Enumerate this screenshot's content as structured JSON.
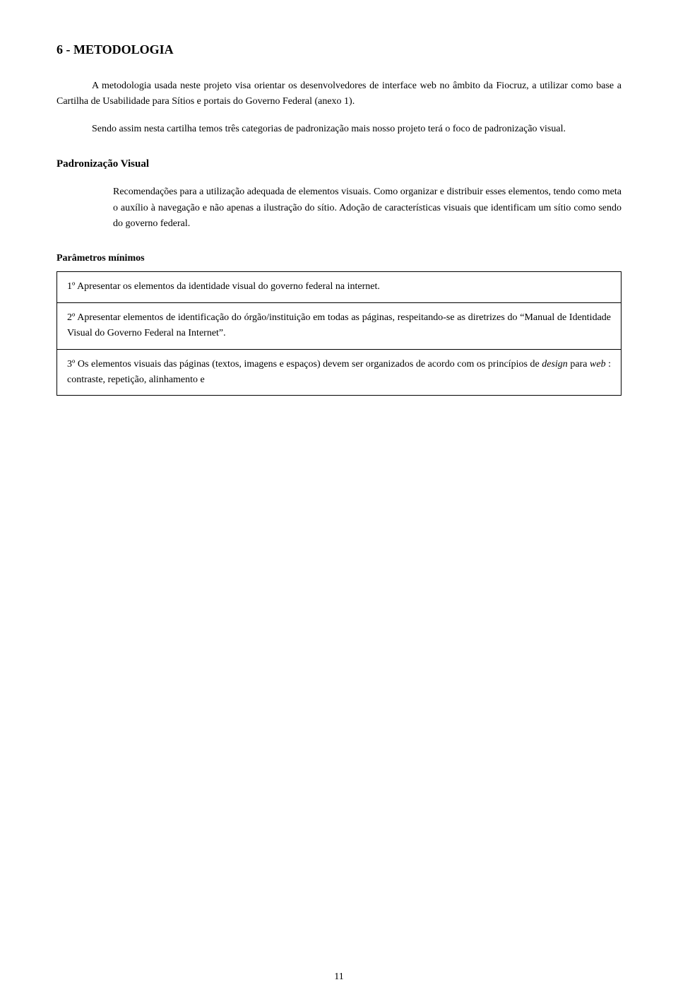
{
  "page": {
    "section_title": "6 - METODOLOGIA",
    "paragraph1": "A metodologia usada neste projeto visa orientar os desenvolvedores de interface web no âmbito da Fiocruz, a utilizar como base a Cartilha de Usabilidade para Sítios e portais do Governo Federal (anexo 1).",
    "paragraph2": "Sendo assim nesta cartilha temos três categorias de padronização mais nosso projeto terá o foco de padronização visual.",
    "subsection_title": "Padronização Visual",
    "paragraph3": "Recomendações para a utilização adequada de elementos visuais. Como organizar e distribuir esses elementos, tendo como meta o auxílio à navegação e não apenas a ilustração do sítio. Adoção de características visuais que identificam um sítio como sendo do governo federal.",
    "parameters_title": "Parâmetros mínimos",
    "table_rows": [
      {
        "id": "row1",
        "text": "1º Apresentar os elementos da identidade visual do governo federal na internet."
      },
      {
        "id": "row2",
        "text_before": "2º Apresentar elementos de identificação do órgão/instituição em todas as páginas, respeitando-se as diretrizes do “Manual de Identidade Visual do Governo Federal na Internet”."
      },
      {
        "id": "row3",
        "text_before": "3º Os elementos visuais das páginas (textos, imagens e espaços) devem ser organizados de acordo com os princípios de",
        "text_italic": "design",
        "text_middle": "para",
        "text_italic2": "web",
        "text_after": ": contraste, repetição, alinhamento e"
      }
    ],
    "page_number": "11"
  }
}
